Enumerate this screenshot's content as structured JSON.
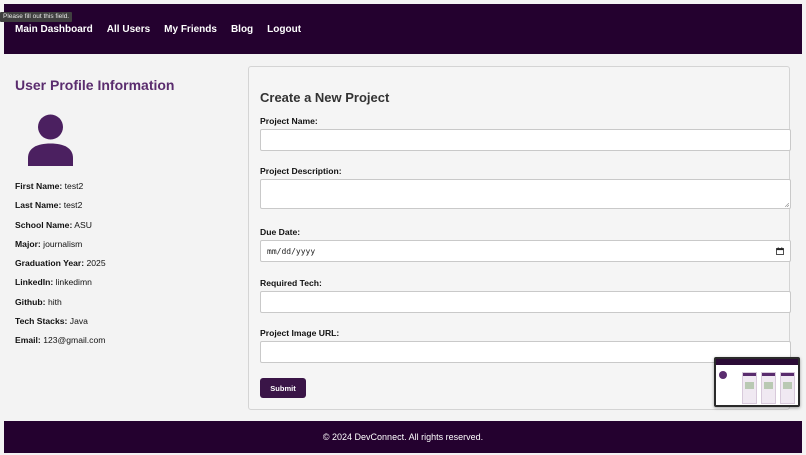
{
  "tooltip": "Please fill out this field.",
  "nav": {
    "items": [
      "Main Dashboard",
      "All Users",
      "My Friends",
      "Blog",
      "Logout"
    ]
  },
  "profile": {
    "title": "User Profile Information",
    "fields": [
      {
        "label": "First Name:",
        "value": "test2"
      },
      {
        "label": "Last Name:",
        "value": "test2"
      },
      {
        "label": "School Name:",
        "value": "ASU"
      },
      {
        "label": "Major:",
        "value": "journalism"
      },
      {
        "label": "Graduation Year:",
        "value": "2025"
      },
      {
        "label": "LinkedIn:",
        "value": "linkedimn"
      },
      {
        "label": "Github:",
        "value": "hith"
      },
      {
        "label": "Tech Stacks:",
        "value": "Java"
      },
      {
        "label": "Email:",
        "value": "123@gmail.com"
      }
    ]
  },
  "form": {
    "title": "Create a New Project",
    "project_name_label": "Project Name:",
    "project_name_value": "",
    "description_label": "Project Description:",
    "description_value": "",
    "due_date_label": "Due Date:",
    "due_date_placeholder": "mm/dd/yyyy",
    "required_tech_label": "Required Tech:",
    "required_tech_value": "",
    "image_url_label": "Project Image URL:",
    "image_url_value": "",
    "submit_label": "Submit"
  },
  "footer": {
    "text": "© 2024 DevConnect. All rights reserved."
  },
  "colors": {
    "nav_bg": "#24012f",
    "accent": "#5a2c6e",
    "button_bg": "#3a1547",
    "avatar": "#4b2060"
  },
  "icons": {
    "avatar": "user-silhouette-icon",
    "date": "calendar-icon"
  }
}
